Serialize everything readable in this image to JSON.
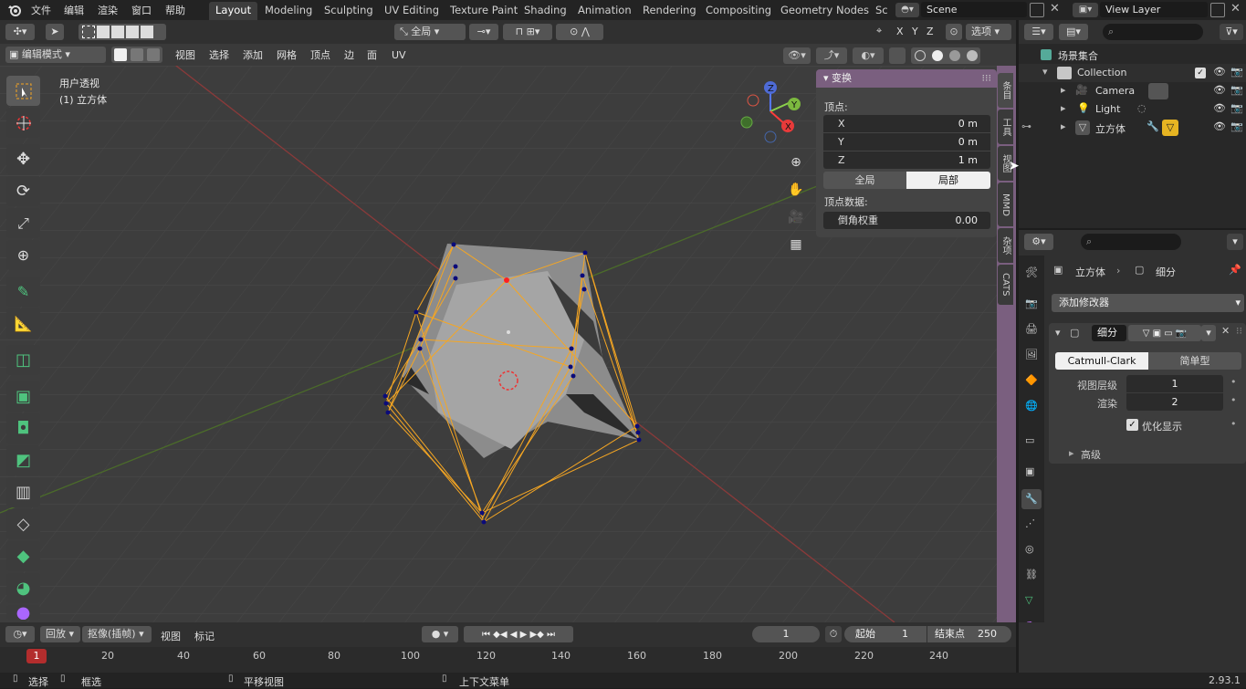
{
  "menu": {
    "file": "文件",
    "edit": "编辑",
    "render": "渲染",
    "window": "窗口",
    "help": "帮助"
  },
  "workspaces": [
    "Layout",
    "Modeling",
    "Sculpting",
    "UV Editing",
    "Texture Paint",
    "Shading",
    "Animation",
    "Rendering",
    "Compositing",
    "Geometry Nodes",
    "Sc"
  ],
  "scene": "Scene",
  "view_layer": "View Layer",
  "header": {
    "orientation": "全局",
    "options": "选项",
    "axes": [
      "X",
      "Y",
      "Z"
    ]
  },
  "viewport": {
    "mode": "编辑模式",
    "menus": [
      "视图",
      "选择",
      "添加",
      "网格",
      "顶点",
      "边",
      "面",
      "UV"
    ],
    "overlay_line1": "用户透视",
    "overlay_line2": "(1) 立方体"
  },
  "npanel": {
    "title": "变换",
    "vertex_label": "顶点:",
    "x_label": "X",
    "x_value": "0 m",
    "y_label": "Y",
    "y_value": "0 m",
    "z_label": "Z",
    "z_value": "1 m",
    "global": "全局",
    "local": "局部",
    "vertex_data": "顶点数据:",
    "bevel_weight": "倒角权重",
    "bevel_value": "0.00"
  },
  "side_tabs": [
    "条目",
    "工具",
    "视图",
    "MMD",
    "杂项",
    "CATS"
  ],
  "outliner": {
    "scene_collection": "场景集合",
    "collection": "Collection",
    "items": [
      "Camera",
      "Light",
      "立方体"
    ]
  },
  "properties": {
    "breadcrumb_object": "立方体",
    "breadcrumb_modifier": "细分",
    "add_modifier": "添加修改器",
    "modifier_name": "细分",
    "catmull": "Catmull-Clark",
    "simple": "简单型",
    "viewport_levels_label": "视图层级",
    "viewport_levels": "1",
    "render_label": "渲染",
    "render_levels": "2",
    "optimize": "优化显示",
    "advanced": "高级"
  },
  "timeline": {
    "playback": "回放",
    "keying": "抠像(插帧)",
    "view": "视图",
    "marker": "标记",
    "current_frame": "1",
    "start_label": "起始",
    "start": "1",
    "end_label": "结束点",
    "end": "250",
    "ticks": [
      "20",
      "40",
      "60",
      "80",
      "100",
      "120",
      "140",
      "160",
      "180",
      "200",
      "220",
      "240"
    ],
    "frame_marker": "1"
  },
  "status": {
    "select": "选择",
    "box": "框选",
    "pan": "平移视图",
    "context": "上下文菜单",
    "version": "2.93.1"
  },
  "colors": {
    "accent": "#4772b3",
    "selected_edge": "#f5a623",
    "vertex": "#0a0a7a",
    "active_vertex": "#ff2020",
    "modifier_tab": "#7a5f7f"
  }
}
